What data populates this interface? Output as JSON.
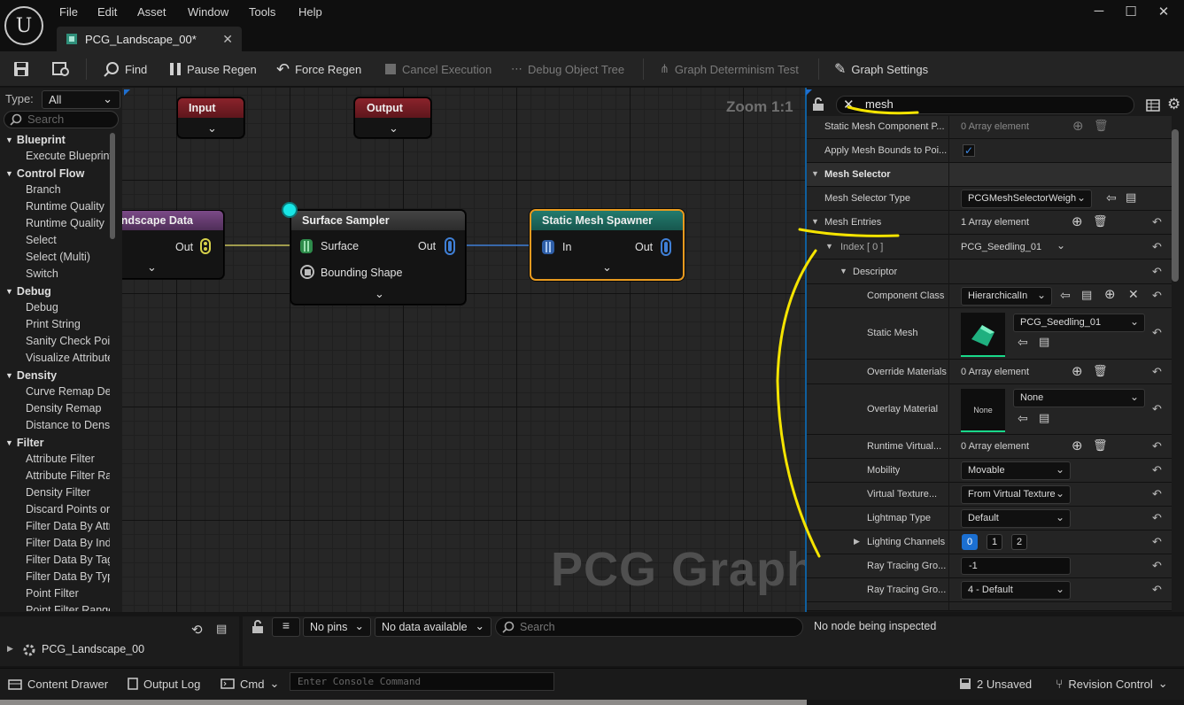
{
  "app": {
    "logo": "U",
    "menus": [
      "File",
      "Edit",
      "Asset",
      "Window",
      "Tools",
      "Help"
    ],
    "tab_title": "PCG_Landscape_00*"
  },
  "toolbar": {
    "find": "Find",
    "pause": "Pause Regen",
    "force": "Force Regen",
    "cancel": "Cancel Execution",
    "debug_tree": "Debug Object Tree",
    "determinism": "Graph Determinism Test",
    "settings": "Graph Settings"
  },
  "palette": {
    "type_label": "Type:",
    "type_value": "All",
    "search_placeholder": "Search",
    "groups": [
      {
        "name": "Blueprint",
        "items": [
          "Execute Blueprint"
        ]
      },
      {
        "name": "Control Flow",
        "items": [
          "Branch",
          "Runtime Quality",
          "Runtime Quality",
          "Select",
          "Select (Multi)",
          "Switch"
        ]
      },
      {
        "name": "Debug",
        "items": [
          "Debug",
          "Print String",
          "Sanity Check Point",
          "Visualize Attribute"
        ]
      },
      {
        "name": "Density",
        "items": [
          "Curve Remap Density",
          "Density Remap",
          "Distance to Density"
        ]
      },
      {
        "name": "Filter",
        "items": [
          "Attribute Filter",
          "Attribute Filter Range",
          "Density Filter",
          "Discard Points on",
          "Filter Data By Attribute",
          "Filter Data By Index",
          "Filter Data By Tag",
          "Filter Data By Type",
          "Point Filter",
          "Point Filter Range"
        ]
      }
    ]
  },
  "graph": {
    "zoom": "Zoom 1:1",
    "watermark": "PCG Graph",
    "nodes": {
      "input": {
        "title": "Input"
      },
      "output": {
        "title": "Output"
      },
      "landscape": {
        "title": "Landscape Data",
        "out": "Out"
      },
      "sampler": {
        "title": "Surface Sampler",
        "surface": "Surface",
        "bounding": "Bounding Shape",
        "out": "Out"
      },
      "spawner": {
        "title": "Static Mesh Spawner",
        "in": "In",
        "out": "Out"
      }
    }
  },
  "details": {
    "search_value": "mesh",
    "rows": {
      "smcp": {
        "name": "Static Mesh Component P...",
        "value": "0 Array element"
      },
      "amb": {
        "name": "Apply Mesh Bounds to Poi..."
      },
      "mesh_selector": {
        "name": "Mesh Selector"
      },
      "mst": {
        "name": "Mesh Selector Type",
        "value": "PCGMeshSelectorWeigh"
      },
      "me": {
        "name": "Mesh Entries",
        "value": "1 Array element"
      },
      "idx": {
        "name": "Index [ 0 ]",
        "value": "PCG_Seedling_01"
      },
      "desc": {
        "name": "Descriptor"
      },
      "cc": {
        "name": "Component Class",
        "value": "HierarchicalIn"
      },
      "sm": {
        "name": "Static Mesh",
        "value": "PCG_Seedling_01"
      },
      "om": {
        "name": "Override Materials",
        "value": "0 Array element"
      },
      "ovm": {
        "name": "Overlay Material",
        "value": "None",
        "thumb": "None"
      },
      "rv": {
        "name": "Runtime Virtual...",
        "value": "0 Array element"
      },
      "mob": {
        "name": "Mobility",
        "value": "Movable"
      },
      "vt": {
        "name": "Virtual Texture...",
        "value": "From Virtual Texture"
      },
      "lt": {
        "name": "Lightmap Type",
        "value": "Default"
      },
      "lc": {
        "name": "Lighting Channels",
        "channels": [
          "0",
          "1",
          "2"
        ]
      },
      "rt1": {
        "name": "Ray Tracing Gro...",
        "value": "-1"
      },
      "rt2": {
        "name": "Ray Tracing Gro...",
        "value": "4 - Default"
      }
    }
  },
  "outliner": {
    "item": "PCG_Landscape_00"
  },
  "debug": {
    "pins": "No pins",
    "data": "No data available",
    "search_placeholder": "Search",
    "status": "No node being inspected"
  },
  "status": {
    "content_drawer": "Content Drawer",
    "output_log": "Output Log",
    "cmd": "Cmd",
    "console_placeholder": "Enter Console Command",
    "unsaved": "2 Unsaved",
    "revision": "Revision Control"
  },
  "colors": {
    "accent_blue": "#0f5f9e",
    "selection_orange": "#e89a1f",
    "annotation_yellow": "#f5e400",
    "spawner_header": "#1d6e62",
    "sampler_header": "#3a3a3a",
    "io_header": "#7a1e25",
    "landscape_header": "#6b3a78"
  }
}
